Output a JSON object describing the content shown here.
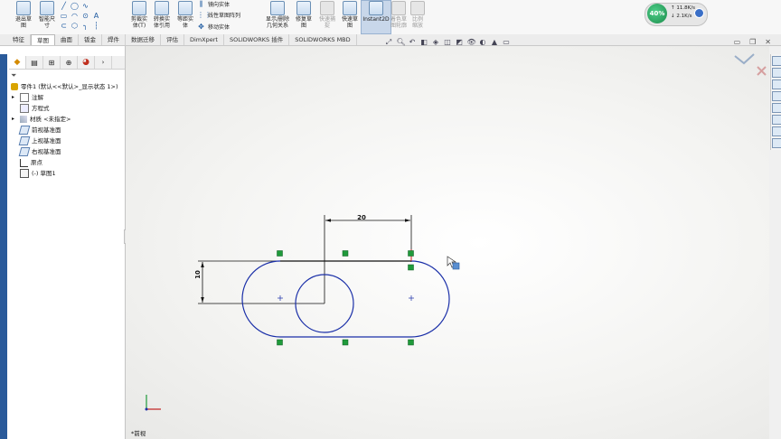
{
  "ribbon": {
    "groups": [
      {
        "label": "退出草\n图",
        "state": "normal"
      },
      {
        "label": "智能尺\n寸",
        "state": "normal"
      },
      {
        "label": "剪裁实\n体(T)",
        "state": "normal"
      },
      {
        "label": "转换实\n体引用",
        "state": "normal"
      },
      {
        "label": "等距实\n体",
        "state": "normal"
      },
      {
        "label": "显示/删除\n几何关系",
        "state": "normal"
      },
      {
        "label": "修复草\n图",
        "state": "normal"
      },
      {
        "label": "快速捕\n捉",
        "state": "disabled"
      },
      {
        "label": "快速草\n图",
        "state": "normal"
      },
      {
        "label": "Instant2D",
        "state": "active"
      },
      {
        "label": "着色草\n图轮廓",
        "state": "disabled"
      },
      {
        "label": "比例\n缩放",
        "state": "disabled"
      }
    ],
    "small_items": [
      "镜向实体",
      "线性草图阵列",
      "移动实体"
    ]
  },
  "net_monitor": {
    "percent": "40%",
    "up": "11.8K/s",
    "down": "2.1K/s"
  },
  "tabs": [
    "特征",
    "草图",
    "曲面",
    "钣金",
    "焊件",
    "数据迁移",
    "评估",
    "DimXpert",
    "SOLIDWORKS 插件",
    "SOLIDWORKS MBD"
  ],
  "active_tab_index": 1,
  "feature_tree": {
    "root": "零件1 (默认<<默认>_显示状态 1>)",
    "items": [
      {
        "label": "注解",
        "icon": "annotation-icon"
      },
      {
        "label": "方程式",
        "icon": "equation-icon"
      },
      {
        "label": "材质 <未指定>",
        "icon": "material-icon"
      },
      {
        "label": "前视基准面",
        "icon": "plane-icon"
      },
      {
        "label": "上视基准面",
        "icon": "plane-icon"
      },
      {
        "label": "右视基准面",
        "icon": "plane-icon"
      },
      {
        "label": "原点",
        "icon": "origin-icon"
      },
      {
        "label": "(-) 草图1",
        "icon": "sketch-icon"
      }
    ]
  },
  "sketch": {
    "dim_horizontal": "20",
    "dim_vertical": "10",
    "view_label": "*前视"
  },
  "colors": {
    "sketch_blue": "#1a2fa8",
    "dim_black": "#111111",
    "relation_green": "#1f9a3a",
    "accent_blue": "#2a5a9a"
  }
}
